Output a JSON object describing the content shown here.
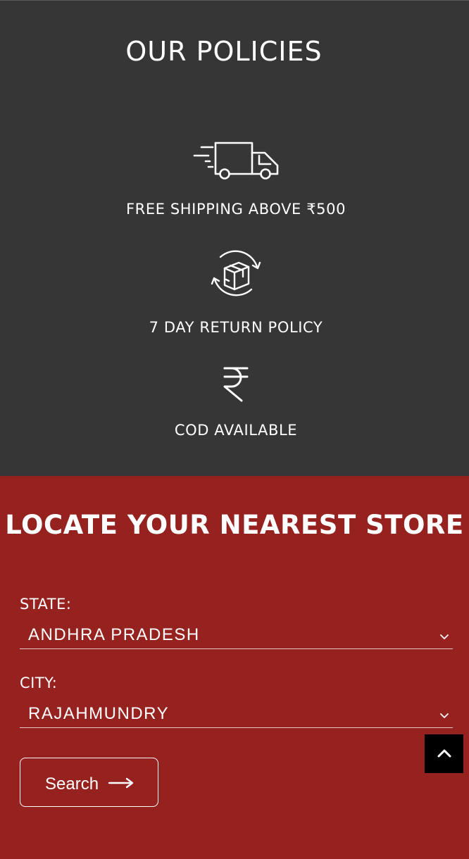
{
  "policies": {
    "title": "OUR POLICIES",
    "items": [
      {
        "icon": "delivery-truck-icon",
        "label": "FREE SHIPPING ABOVE ₹500"
      },
      {
        "icon": "return-box-icon",
        "label": "7 DAY RETURN POLICY"
      },
      {
        "icon": "rupee-icon",
        "label": "COD AVAILABLE"
      }
    ]
  },
  "store_locator": {
    "title": "LOCATE YOUR NEAREST STORE",
    "state_label": "STATE:",
    "state_value": "ANDHRA PRADESH",
    "city_label": "CITY:",
    "city_value": "RAJAHMUNDRY",
    "search_label": "Search"
  },
  "colors": {
    "policies_bg": "#363636",
    "locator_bg": "#962220",
    "back_to_top_bg": "#000000"
  },
  "icons": {
    "search_arrow": "arrow-right-icon",
    "select_chevron": "chevron-down-icon",
    "back_to_top": "chevron-up-icon"
  }
}
